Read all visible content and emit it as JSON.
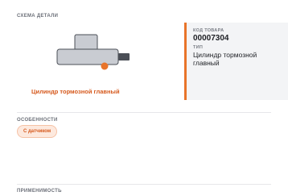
{
  "scheme": {
    "section_title": "СХЕМА ДЕТАЛИ",
    "part_name": "Цилиндр тормозной главный"
  },
  "info": {
    "code_key": "КОД ТОВАРА",
    "code_value": "00007304",
    "type_key": "ТИП",
    "type_value": "Цилиндр тормозной главный"
  },
  "features": {
    "section_title": "ОСОБЕННОСТИ",
    "badge": "С датчиком"
  },
  "applicability": {
    "section_title": "ПРИМЕНИМОСТЬ"
  },
  "colors": {
    "accent": "#e8742a",
    "part_fill": "#c9ccd2",
    "part_stroke": "#4b4f57"
  }
}
